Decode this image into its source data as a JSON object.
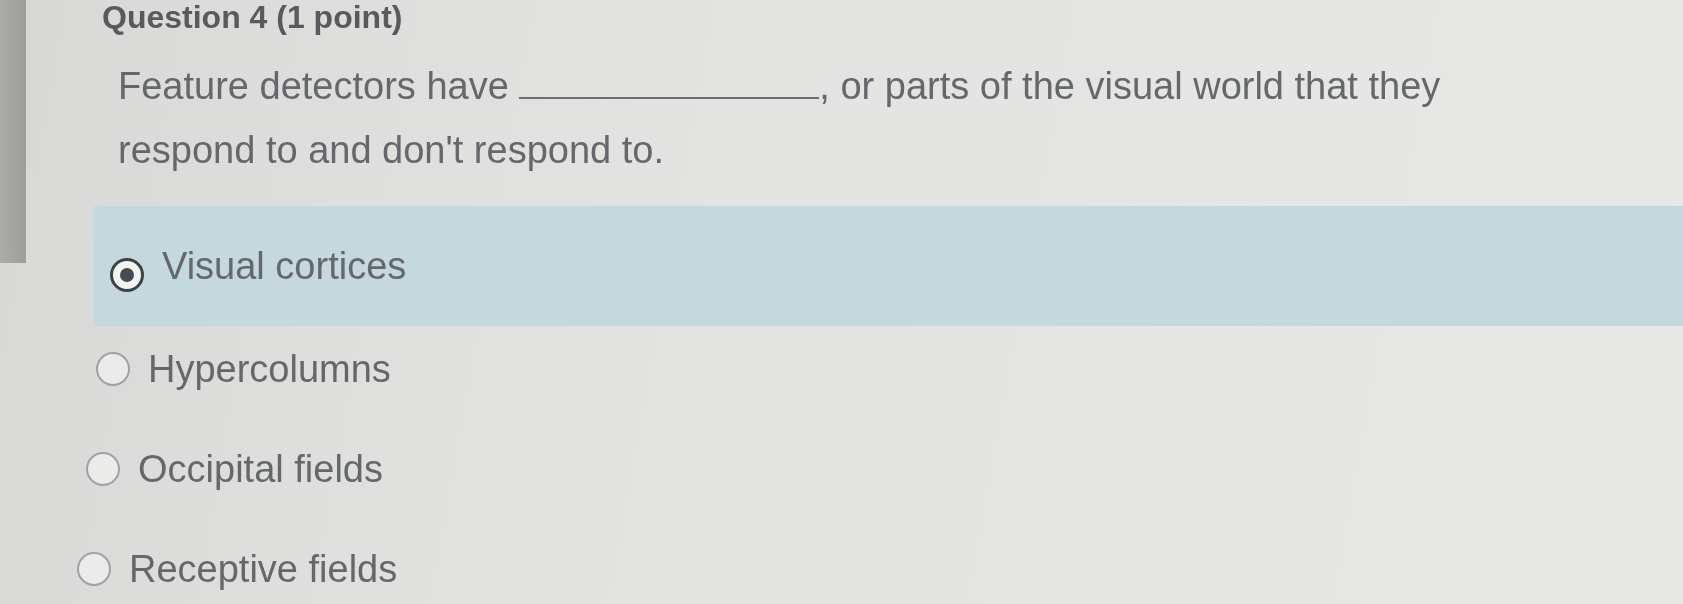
{
  "question": {
    "header": "Question 4 (1 point)",
    "text_before": "Feature detectors have",
    "text_after": ", or parts of the visual world that they respond to and don't respond to."
  },
  "options": [
    {
      "label": "Visual cortices",
      "selected": true
    },
    {
      "label": "Hypercolumns",
      "selected": false
    },
    {
      "label": "Occipital fields",
      "selected": false
    },
    {
      "label": "Receptive fields",
      "selected": false
    }
  ]
}
